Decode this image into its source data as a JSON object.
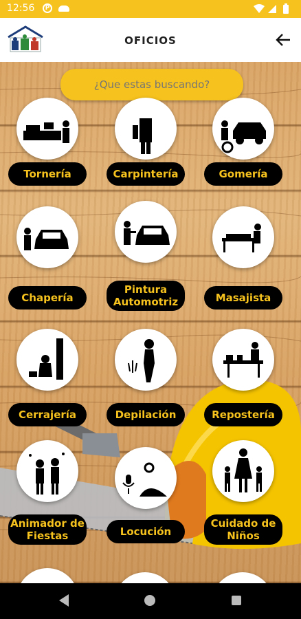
{
  "status": {
    "time": "12:56"
  },
  "header": {
    "title": "OFICIOS"
  },
  "search": {
    "placeholder": "¿Que estas buscando?"
  },
  "colors": {
    "accent": "#f6c21d",
    "pill_bg": "#000000"
  },
  "services": [
    {
      "label": "Tornería",
      "icon": "lathe-worker-icon"
    },
    {
      "label": "Carpintería",
      "icon": "carpenter-icon"
    },
    {
      "label": "Gomería",
      "icon": "tire-repair-icon"
    },
    {
      "label": "Chapería",
      "icon": "car-bodywork-icon"
    },
    {
      "label": "Pintura Automotriz",
      "icon": "car-painting-icon"
    },
    {
      "label": "Masajista",
      "icon": "massage-icon"
    },
    {
      "label": "Cerrajería",
      "icon": "locksmith-icon"
    },
    {
      "label": "Depilación",
      "icon": "hair-removal-icon"
    },
    {
      "label": "Repostería",
      "icon": "pastry-icon"
    },
    {
      "label": "Animador de Fiestas",
      "icon": "party-entertainer-icon"
    },
    {
      "label": "Locución",
      "icon": "microphone-icon"
    },
    {
      "label": "Cuidado de Niños",
      "icon": "childcare-icon"
    }
  ]
}
